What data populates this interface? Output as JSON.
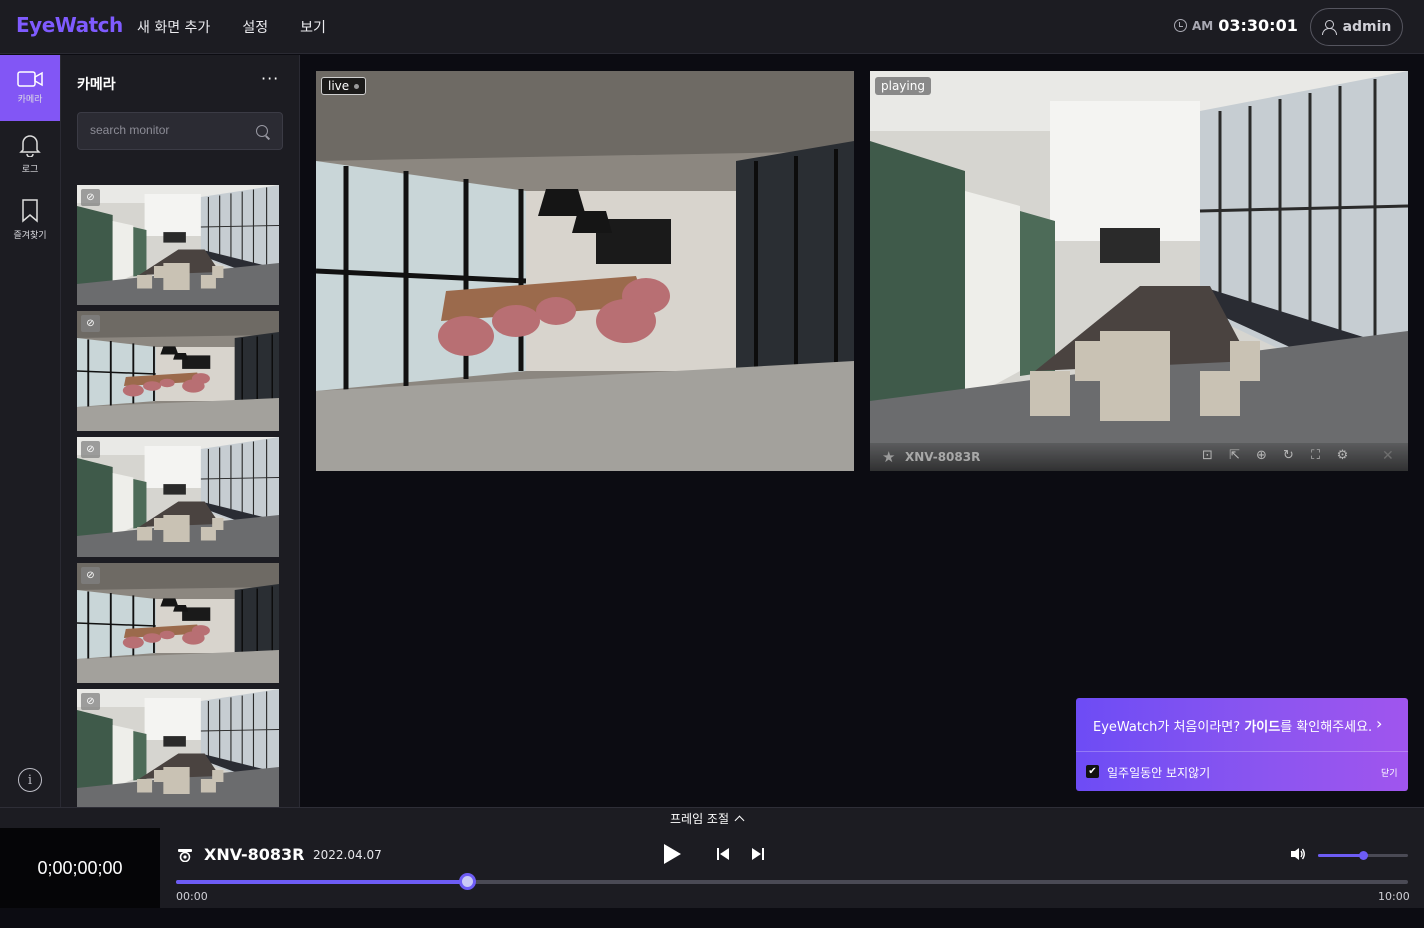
{
  "app": {
    "logo": "EyeWatch",
    "nav": [
      "새 화면 추가",
      "설정",
      "보기"
    ],
    "clock": {
      "ampm": "AM",
      "time": "03:30:01"
    },
    "user": "admin"
  },
  "rail": {
    "items": [
      {
        "label": "카메라",
        "icon": "camera-icon",
        "active": true
      },
      {
        "label": "로그",
        "icon": "bell-icon",
        "active": false
      },
      {
        "label": "즐겨찾기",
        "icon": "bookmark-icon",
        "active": false
      }
    ],
    "info_symbol": "i"
  },
  "camera_panel": {
    "title": "카메라",
    "more_symbol": "···",
    "search_placeholder": "search monitor",
    "thumbnails": [
      "scene-white-office",
      "scene-concrete-office",
      "scene-white-office",
      "scene-concrete-office",
      "scene-white-office"
    ]
  },
  "tiles": [
    {
      "badge": "live",
      "scene": "scene-concrete-office"
    },
    {
      "badge": "playing",
      "scene": "scene-white-office",
      "camera_name": "XNV-8083R"
    }
  ],
  "guide": {
    "message_prefix": "EyeWatch가 처음이라면? ",
    "message_bold": "가이드",
    "message_suffix": "를 확인해주세요.",
    "checkbox_label": "일주일동안 보지않기",
    "checkbox_checked": true,
    "close_label": "닫기"
  },
  "player": {
    "frame_control_label": "프레임 조절",
    "timecode": "0;00;00;00",
    "camera_name": "XNV-8083R",
    "date": "2022.04.07",
    "time_start": "00:00",
    "time_end": "10:00",
    "progress": 0.236,
    "volume": 0.5,
    "accent_color": "#6d5cf5"
  }
}
